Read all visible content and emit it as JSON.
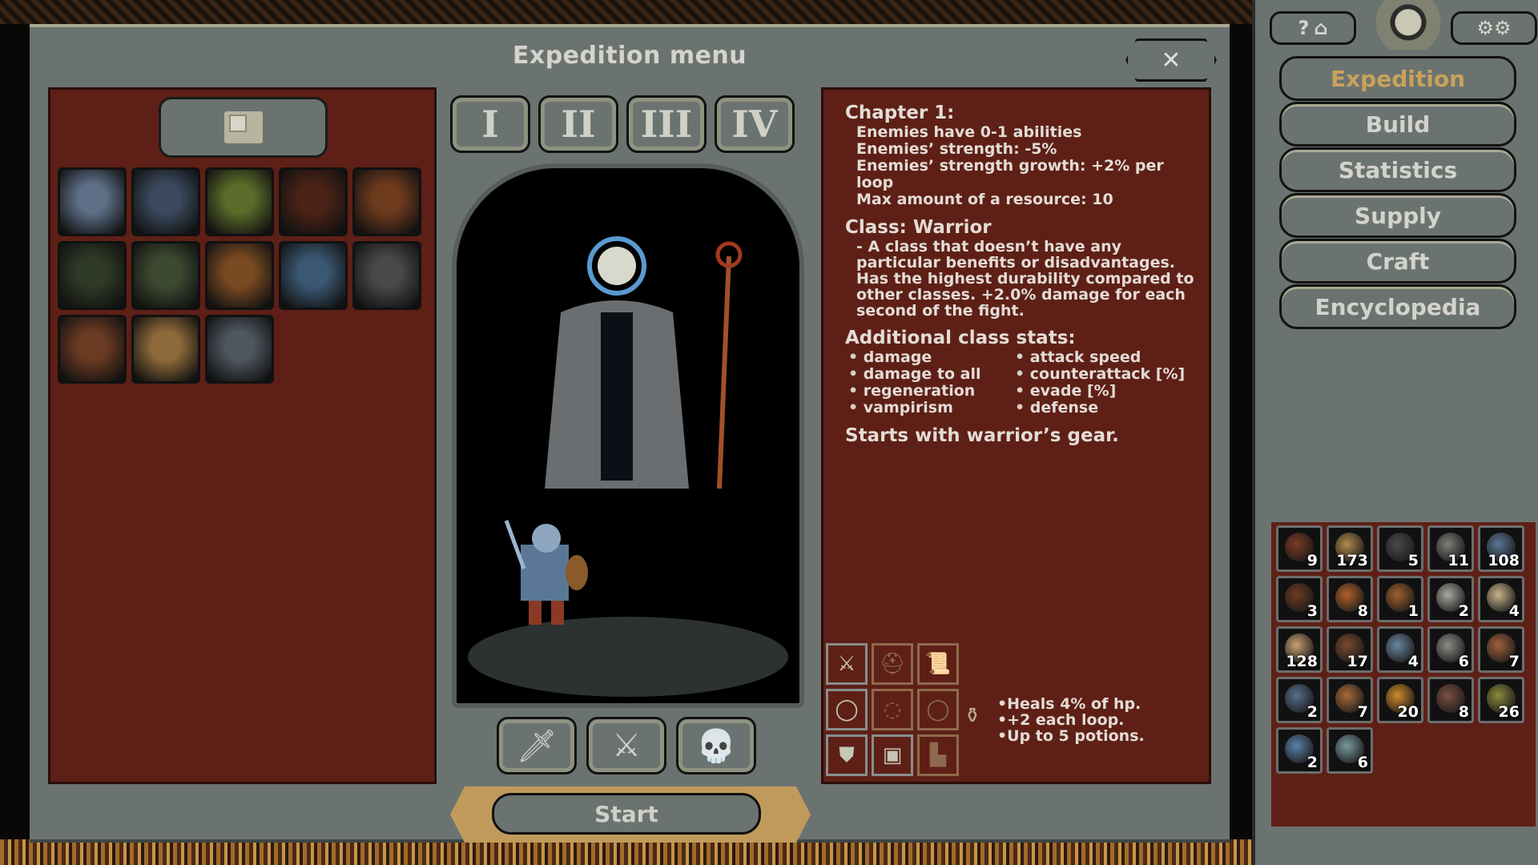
{
  "dialog": {
    "title": "Expedition menu",
    "close_icon": "crossed-swords-close"
  },
  "left_panel": {
    "deck_button_icon": "card-deck-icon",
    "cards": [
      {
        "name": "lich-card",
        "color": "#5d6f86"
      },
      {
        "name": "cemetery-card",
        "color": "#3b4a5e"
      },
      {
        "name": "grove-card",
        "color": "#5b6b2a"
      },
      {
        "name": "spider-cocoon-card",
        "color": "#4a2316"
      },
      {
        "name": "lighthouse-card",
        "color": "#6e3a1e"
      },
      {
        "name": "forest-card",
        "color": "#2f3a26"
      },
      {
        "name": "thicket-card",
        "color": "#3d4a30"
      },
      {
        "name": "blood-grove-card",
        "color": "#7a4a22"
      },
      {
        "name": "river-card",
        "color": "#3b5873"
      },
      {
        "name": "battlefield-card",
        "color": "#4a4848"
      },
      {
        "name": "rock-card",
        "color": "#6b3a22"
      },
      {
        "name": "mountain-card",
        "color": "#8e6a3a"
      },
      {
        "name": "village-card",
        "color": "#4e5660"
      }
    ]
  },
  "center_panel": {
    "chapter_tabs": [
      "I",
      "II",
      "III",
      "IV"
    ],
    "class_buttons": [
      {
        "name": "warrior",
        "glyph": "🗡"
      },
      {
        "name": "rogue",
        "glyph": "⚔"
      },
      {
        "name": "necromancer",
        "glyph": "💀"
      }
    ],
    "start_label": "Start"
  },
  "info_panel": {
    "chapter_title": "Chapter 1:",
    "chapter_lines": [
      "Enemies have 0-1 abilities",
      "Enemies’ strength: -5%",
      "Enemies’ strength growth: +2% per loop",
      "Max amount of a resource: 10"
    ],
    "class_title": "Class: Warrior",
    "class_desc": "- A class that doesn’t have any particular benefits or disadvantages. Has the highest durability compared to other classes. +2.0% damage for each second of the fight.",
    "stats_title": "Additional class stats:",
    "stats": [
      "damage",
      "attack speed",
      "damage to all",
      "counterattack [%]",
      "regeneration",
      "evade [%]",
      "vampirism",
      "defense"
    ],
    "gear_note": "Starts with warrior’s gear.",
    "gear_slots": [
      {
        "name": "sword-slot",
        "glyph": "⚔",
        "active": true
      },
      {
        "name": "helmet-slot",
        "glyph": "⛑",
        "active": false
      },
      {
        "name": "scroll-slot",
        "glyph": "📜",
        "active": false
      },
      {
        "name": "ring-slot",
        "glyph": "◯",
        "active": true
      },
      {
        "name": "amulet-slot",
        "glyph": "◌",
        "active": false
      },
      {
        "name": "ring2-slot",
        "glyph": "◯",
        "active": false
      },
      {
        "name": "shield-slot",
        "glyph": "⛊",
        "active": true
      },
      {
        "name": "armor-slot",
        "glyph": "▣",
        "active": true
      },
      {
        "name": "boots-slot",
        "glyph": "▙",
        "active": false
      }
    ],
    "potion_lines": [
      "•Heals 4% of hp.",
      "•+2 each loop.",
      "•Up to 5 potions."
    ]
  },
  "sidebar": {
    "help_label": "?",
    "settings_icon": "gear-icon",
    "nav": [
      {
        "label": "Expedition",
        "active": true
      },
      {
        "label": "Build",
        "active": false
      },
      {
        "label": "Statistics",
        "active": false
      },
      {
        "label": "Supply",
        "active": false
      },
      {
        "label": "Craft",
        "active": false
      },
      {
        "label": "Encyclopedia",
        "active": false
      }
    ],
    "resources": [
      {
        "count": "9",
        "color": "#7a3a24"
      },
      {
        "count": "173",
        "color": "#b08a4a"
      },
      {
        "count": "5",
        "color": "#4a4a4a"
      },
      {
        "count": "11",
        "color": "#7a7e76"
      },
      {
        "count": "108",
        "color": "#5a7896"
      },
      {
        "count": "3",
        "color": "#6e3a22"
      },
      {
        "count": "8",
        "color": "#b0602a"
      },
      {
        "count": "1",
        "color": "#a0602e"
      },
      {
        "count": "2",
        "color": "#a8a8a0"
      },
      {
        "count": "4",
        "color": "#c8b48a"
      },
      {
        "count": "128",
        "color": "#c8a070"
      },
      {
        "count": "17",
        "color": "#7a4a2e"
      },
      {
        "count": "4",
        "color": "#6a86a0"
      },
      {
        "count": "6",
        "color": "#8a8e86"
      },
      {
        "count": "7",
        "color": "#a0603a"
      },
      {
        "count": "2",
        "color": "#56708a"
      },
      {
        "count": "7",
        "color": "#a86a3a"
      },
      {
        "count": "20",
        "color": "#d08a2a"
      },
      {
        "count": "8",
        "color": "#7a5040"
      },
      {
        "count": "26",
        "color": "#8a8a3a"
      },
      {
        "count": "2",
        "color": "#5a82a8"
      },
      {
        "count": "6",
        "color": "#7a9aa0"
      }
    ]
  },
  "colors": {
    "panel_red": "#5e2016",
    "frame_gray": "#6b7371",
    "accent_gold": "#c9a25a",
    "text_light": "#e3dcd6"
  }
}
